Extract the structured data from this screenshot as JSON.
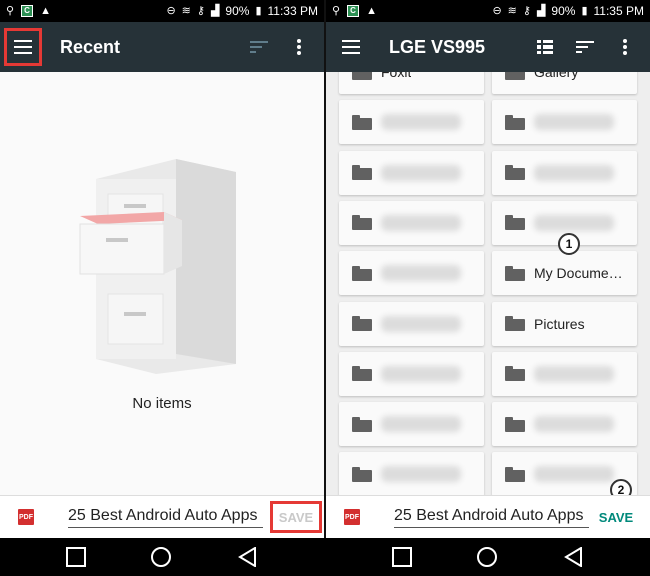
{
  "left": {
    "status": {
      "battery": "90%",
      "time": "11:33 PM"
    },
    "appbar": {
      "title": "Recent"
    },
    "empty_text": "No items",
    "savebar": {
      "pdf_label": "PDF",
      "filename": "25 Best Android Auto Apps",
      "save_label": "SAVE"
    }
  },
  "right": {
    "status": {
      "battery": "90%",
      "time": "11:35 PM"
    },
    "appbar": {
      "title": "LGE VS995"
    },
    "folders": [
      "Foxit",
      "Gallery",
      "",
      "",
      "",
      "",
      "",
      "",
      "",
      "My Docume…",
      "",
      "Pictures",
      "",
      "",
      "",
      "",
      "",
      ""
    ],
    "callouts": [
      "1",
      "2"
    ],
    "savebar": {
      "pdf_label": "PDF",
      "filename": "25 Best Android Auto Apps",
      "save_label": "SAVE"
    }
  },
  "colors": {
    "appbar": "#263238",
    "save_enabled": "#00897b",
    "highlight": "#e53935",
    "pdf": "#d32f2f"
  }
}
